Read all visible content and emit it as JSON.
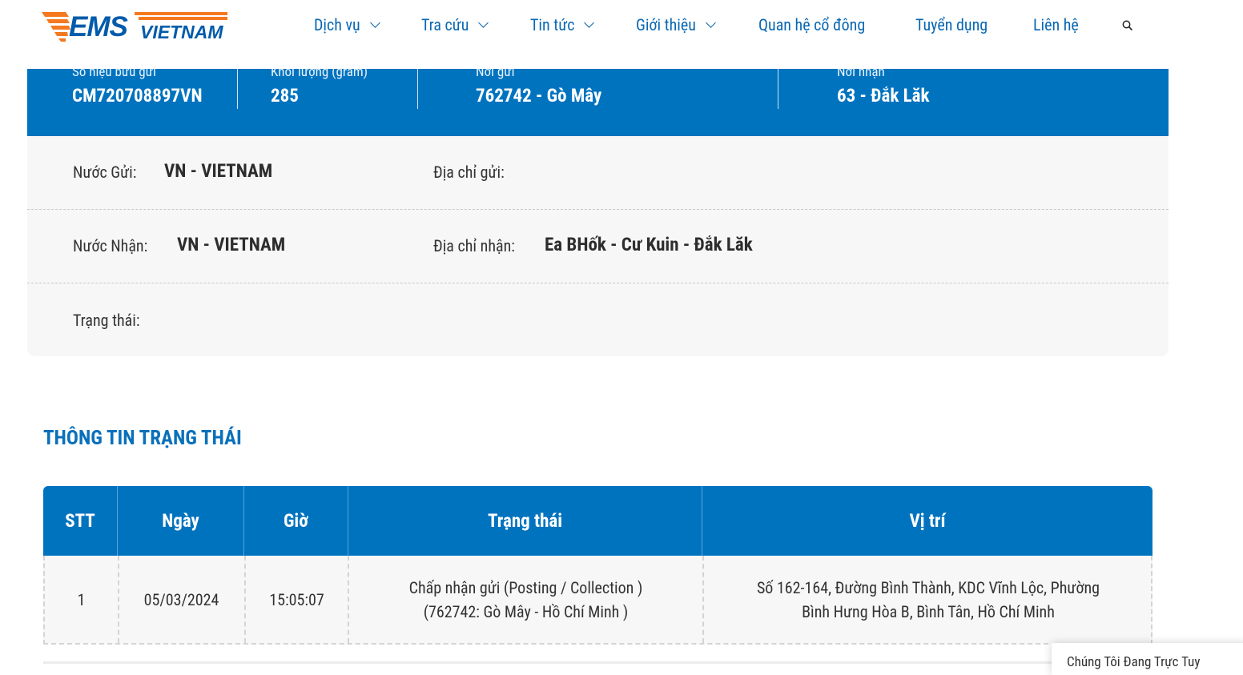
{
  "header": {
    "logo_text_main": "EMS",
    "logo_text_sub": "VIETNAM",
    "nav": [
      {
        "label": "Dịch vụ",
        "dropdown": true
      },
      {
        "label": "Tra cứu",
        "dropdown": true
      },
      {
        "label": "Tin tức",
        "dropdown": true
      },
      {
        "label": "Giới thiệu",
        "dropdown": true
      },
      {
        "label": "Quan hệ cổ đông",
        "dropdown": false
      },
      {
        "label": "Tuyển dụng",
        "dropdown": false
      },
      {
        "label": "Liên hệ",
        "dropdown": false
      }
    ],
    "search_icon": "search-icon"
  },
  "summary": {
    "tracking_label": "Số hiệu bưu gửi",
    "tracking_value": "CM720708897VN",
    "weight_label": "Khối lượng (gram)",
    "weight_value": "285",
    "origin_label": "Nơi gửi",
    "origin_value": "762742 - Gò Mây",
    "dest_label": "Nơi nhận",
    "dest_value": "63 - Đắk Lăk"
  },
  "detail": {
    "send_country_label": "Nước Gửi:",
    "send_country_value": "VN - VIETNAM",
    "send_address_label": "Địa chỉ gửi:",
    "send_address_value": "",
    "recv_country_label": "Nước Nhận:",
    "recv_country_value": "VN - VIETNAM",
    "recv_address_label": "Địa chỉ nhận:",
    "recv_address_value": "Ea BHốk - Cư Kuin - Đắk Lăk",
    "status_label": "Trạng thái:",
    "status_value": ""
  },
  "status_section": {
    "title": "THÔNG TIN TRẠNG THÁI",
    "columns": [
      "STT",
      "Ngày",
      "Giờ",
      "Trạng thái",
      "Vị trí"
    ],
    "rows": [
      {
        "stt": "1",
        "date": "05/03/2024",
        "time": "15:05:07",
        "status_line1": "Chấp nhận gửi (Posting / Collection )",
        "status_line2": "(762742: Gò Mây - Hồ Chí Minh )",
        "location_line1": "Số 162-164, Đường Bình Thành, KDC Vĩnh Lộc, Phường",
        "location_line2": "Bình Hưng Hòa B, Bình Tân, Hồ Chí Minh"
      }
    ]
  },
  "chat_widget": {
    "label": "Chúng Tôi Đang Trực Tuy"
  },
  "colors": {
    "brand_blue": "#0073bf",
    "nav_text": "#0a67b2",
    "logo_orange": "#f47920",
    "logo_blue": "#005baa"
  }
}
